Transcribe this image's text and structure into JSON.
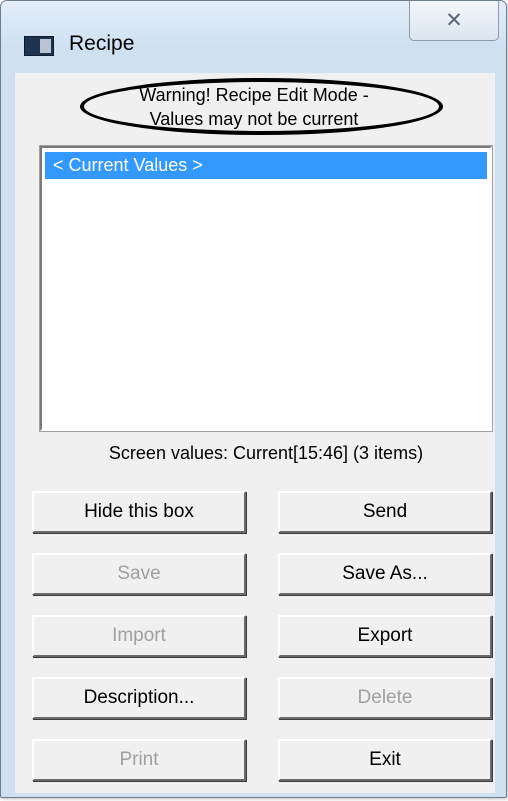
{
  "window": {
    "title": "Recipe",
    "close_glyph": "✕",
    "app_icon": "window-icon"
  },
  "warning": {
    "line1": "Warning! Recipe Edit Mode -",
    "line2": "Values may not be current"
  },
  "recipe_list": {
    "items": [
      "< Current Values >"
    ],
    "selected_index": 0
  },
  "status": "Screen values: Current[15:46] (3 items)",
  "buttons": {
    "hide_this_box": "Hide this box",
    "send": "Send",
    "save": "Save",
    "save_as": "Save As...",
    "import": "Import",
    "export": "Export",
    "description": "Description...",
    "delete": "Delete",
    "print": "Print",
    "exit": "Exit"
  },
  "colors": {
    "selection": "#3399ff",
    "frame": "#cfe0f1",
    "disabled_text": "#a0a0a0"
  }
}
